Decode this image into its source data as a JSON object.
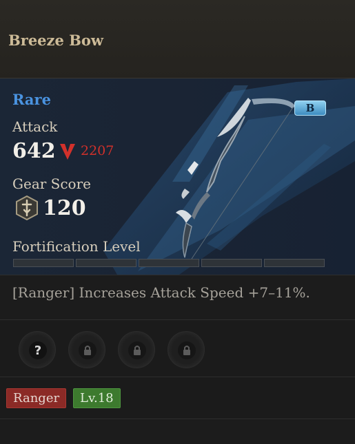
{
  "item": {
    "name": "Breeze Bow",
    "rarity": "Rare",
    "grade": "B",
    "attack_label": "Attack",
    "attack_value": "642",
    "compare_value": "2207",
    "gear_score_label": "Gear Score",
    "gear_score_value": "120",
    "fortification_label": "Fortification Level",
    "fortification_level": 0,
    "fortification_max": 5,
    "description": "[Ranger] Increases Attack Speed +7–11%."
  },
  "sockets": [
    {
      "icon": "question-icon"
    },
    {
      "icon": "lock-icon"
    },
    {
      "icon": "lock-icon"
    },
    {
      "icon": "lock-icon"
    }
  ],
  "tags": {
    "class": "Ranger",
    "level": "Lv.18"
  },
  "colors": {
    "rarity": "#4a93e0",
    "compare_down": "#d2312b",
    "tag_class": "#8b2a26",
    "tag_level": "#3d7a2e"
  }
}
